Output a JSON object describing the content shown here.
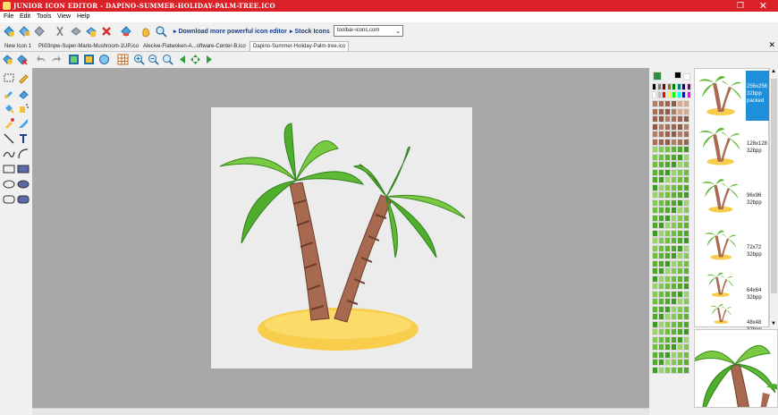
{
  "window": {
    "title": "JUNIOR ICON EDITOR - DAPINO-SUMMER-HOLIDAY-PALM-TREE.ICO",
    "restore_glyph": "❐",
    "close_glyph": "✕"
  },
  "menu": [
    "File",
    "Edit",
    "Tools",
    "View",
    "Help"
  ],
  "toolbar": {
    "download_link": "Download more powerful icon editor",
    "stock_link": "Stock Icons",
    "site_combo_value": "toolbar-icons.com"
  },
  "tabs": [
    "New Icon 1",
    "Pli03npw-Super-Mario-Mushroom-1UP.ico",
    "Alecive-Flatwoken-A...oftware-Center-B.ico",
    "Dapino-Summer-Holiday-Palm-tree.ico"
  ],
  "active_tab_index": 3,
  "formats": [
    {
      "size": "256x256",
      "depth": "32bpp",
      "extra": "packed",
      "selected": true
    },
    {
      "size": "128x128",
      "depth": "32bpp",
      "selected": false
    },
    {
      "size": "96x96",
      "depth": "32bpp",
      "selected": false
    },
    {
      "size": "72x72",
      "depth": "32bpp",
      "selected": false
    },
    {
      "size": "64x64",
      "depth": "32bpp",
      "selected": false
    },
    {
      "size": "48x48",
      "depth": "32bpp",
      "selected": false
    }
  ],
  "colors": {
    "title_bg": "#d92127",
    "canvas_bg": "#a8a8a8",
    "selection": "#1e8fd8",
    "leaf_light": "#67c23a",
    "leaf_dark": "#2f8f1e",
    "trunk": "#a0604a",
    "sand": "#f6c640"
  },
  "palette_top_colors": [
    "#000000",
    "#808080",
    "#800000",
    "#808000",
    "#008000",
    "#008080",
    "#000080",
    "#800080",
    "#ffffff",
    "#c0c0c0",
    "#ff0000",
    "#ffff00",
    "#00ff00",
    "#00ffff",
    "#0000ff",
    "#ff00ff"
  ],
  "icons": {
    "tools": [
      "select-rect-icon",
      "pencil-icon",
      "brush-icon",
      "eraser-icon",
      "fill-icon",
      "spray-icon",
      "picker-icon",
      "pen-icon",
      "line-icon",
      "text-icon",
      "curve-icon",
      "arc-icon",
      "rect-icon",
      "filled-rect-icon",
      "ellipse-icon",
      "filled-ellipse-icon",
      "round-rect-icon",
      "filled-round-rect-icon"
    ]
  }
}
